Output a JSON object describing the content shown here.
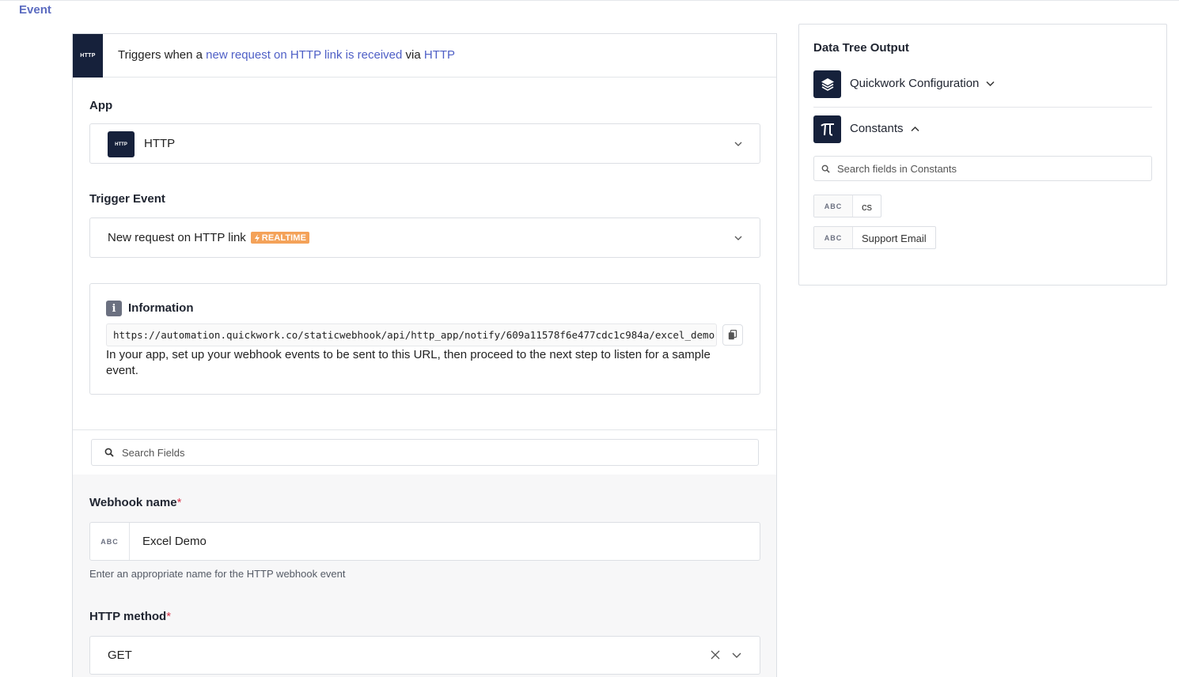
{
  "tab": {
    "label": "Event"
  },
  "trigger": {
    "icon_text": "HTTP",
    "prefix": "Triggers when a ",
    "event_link": "new request on HTTP link is received",
    "via": " via ",
    "app_link": "HTTP"
  },
  "app": {
    "label": "App",
    "icon_text": "HTTP",
    "value": "HTTP"
  },
  "trigger_event": {
    "label": "Trigger Event",
    "value": "New request on HTTP link",
    "badge": "REALTIME"
  },
  "information": {
    "title": "Information",
    "url": "https://automation.quickwork.co/staticwebhook/api/http_app/notify/609a11578f6e477cdc1c984a/excel_demo",
    "description": "In your app, set up your webhook events to be sent to this URL, then proceed to the next step to listen for a sample event."
  },
  "search_fields": {
    "placeholder": "Search Fields"
  },
  "webhook_name": {
    "label": "Webhook name",
    "required_mark": "*",
    "type_tag": "ABC",
    "value": "Excel Demo",
    "hint": "Enter an appropriate name for the HTTP webhook event"
  },
  "http_method": {
    "label": "HTTP method",
    "required_mark": "*",
    "value": "GET"
  },
  "data_tree": {
    "title": "Data Tree Output",
    "sections": [
      {
        "label": "Quickwork Configuration",
        "icon": "layers-icon",
        "expanded": false
      },
      {
        "label": "Constants",
        "icon": "pi-icon",
        "expanded": true
      }
    ],
    "search_placeholder": "Search fields in Constants",
    "constants": [
      {
        "type": "ABC",
        "name": "cs"
      },
      {
        "type": "ABC",
        "name": "Support Email"
      }
    ]
  },
  "colors": {
    "accent": "#4e5fc6",
    "dark_icon": "#16213b",
    "realtime_badge": "#f4a259",
    "required": "#d9344a"
  }
}
